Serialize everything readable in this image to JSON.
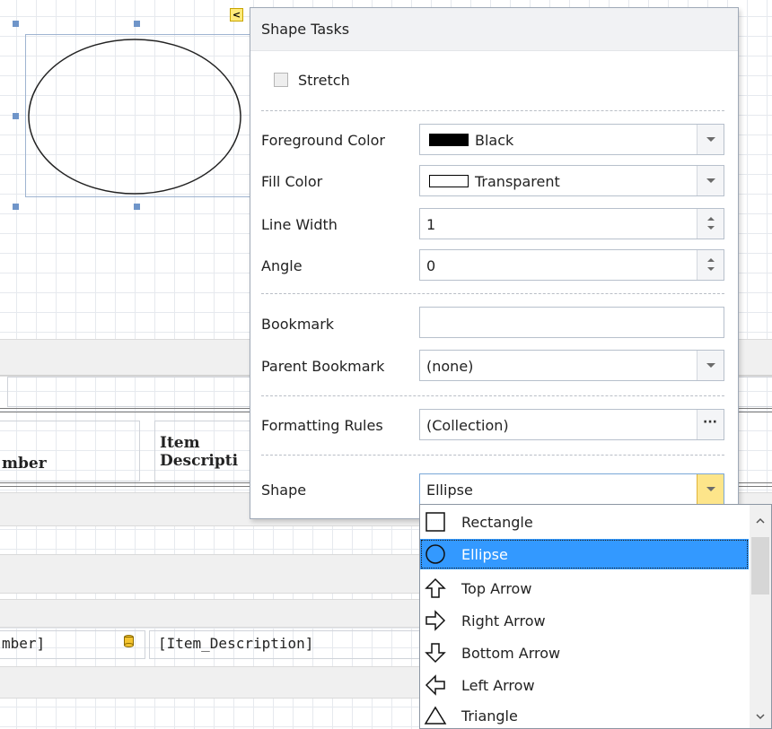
{
  "smart_tag": {
    "glyph": "<"
  },
  "report": {
    "header_cells": [
      "mber",
      "Item",
      "Descripti"
    ],
    "data_cells": [
      "mber]",
      "[Item_Description]"
    ]
  },
  "panel": {
    "title": "Shape Tasks",
    "stretch_label": "Stretch",
    "fields": {
      "foreground_color": {
        "label": "Foreground Color",
        "value": "Black",
        "swatch": "#000000"
      },
      "fill_color": {
        "label": "Fill Color",
        "value": "Transparent",
        "swatch": "#ffffff"
      },
      "line_width": {
        "label": "Line Width",
        "value": "1"
      },
      "angle": {
        "label": "Angle",
        "value": "0"
      },
      "bookmark": {
        "label": "Bookmark",
        "value": ""
      },
      "parent_bookmark": {
        "label": "Parent Bookmark",
        "value": "(none)"
      },
      "formatting_rules": {
        "label": "Formatting Rules",
        "value": "(Collection)",
        "button": "···"
      },
      "shape": {
        "label": "Shape",
        "value": "Ellipse"
      }
    }
  },
  "shape_list": {
    "items": [
      {
        "label": "Rectangle",
        "icon": "rectangle-icon"
      },
      {
        "label": "Ellipse",
        "icon": "ellipse-icon",
        "selected": true
      },
      {
        "label": "Top Arrow",
        "icon": "top-arrow-icon"
      },
      {
        "label": "Right Arrow",
        "icon": "right-arrow-icon"
      },
      {
        "label": "Bottom Arrow",
        "icon": "bottom-arrow-icon"
      },
      {
        "label": "Left Arrow",
        "icon": "left-arrow-icon"
      },
      {
        "label": "Triangle",
        "icon": "triangle-icon"
      }
    ]
  },
  "colors": {
    "selection": "#3399ff",
    "smart_tag": "#ffea7a"
  }
}
